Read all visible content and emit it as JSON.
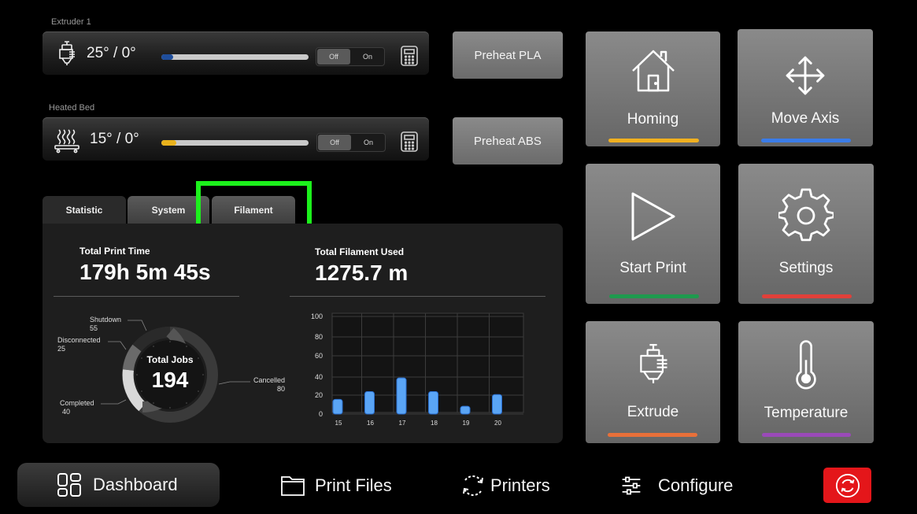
{
  "extruder": {
    "label": "Extruder 1",
    "temp": "25° / 0°",
    "progress": 0.08,
    "bar_color": "#1f4e9c",
    "toggle_off": "Off",
    "toggle_on": "On"
  },
  "bed": {
    "label": "Heated Bed",
    "temp": "15° / 0°",
    "progress": 0.1,
    "bar_color": "#e9b21c",
    "toggle_off": "Off",
    "toggle_on": "On"
  },
  "preheat": {
    "pla": "Preheat PLA",
    "abs": "Preheat ABS"
  },
  "tabs": {
    "statistic": "Statistic",
    "system": "System",
    "filament": "Filament"
  },
  "stats": {
    "print_time_label": "Total Print Time",
    "print_time_value": "179h 5m 45s",
    "filament_label": "Total Filament Used",
    "filament_value": "1275.7 m",
    "jobs_label": "Total Jobs",
    "jobs_value": "194",
    "donut": [
      {
        "name": "Shutdown",
        "value": "55"
      },
      {
        "name": "Disconnected",
        "value": "25"
      },
      {
        "name": "Cancelled",
        "value": "80"
      },
      {
        "name": "Completed",
        "value": "40"
      }
    ]
  },
  "chart_data": {
    "type": "bar",
    "categories": [
      "15",
      "16",
      "17",
      "18",
      "19",
      "20"
    ],
    "y_ticks": [
      "100",
      "80",
      "60",
      "40",
      "20",
      "0"
    ],
    "ylim": [
      0,
      100
    ],
    "series": [
      {
        "values": [
          15,
          23,
          37,
          23,
          8,
          20
        ],
        "color": "#5aa5f5"
      }
    ],
    "grid": true
  },
  "tiles": {
    "homing": {
      "label": "Homing",
      "accent": "#f0b020",
      "icon": "house-icon"
    },
    "move_axis": {
      "label": "Move Axis",
      "accent": "#3a7ce8",
      "icon": "move-arrows-icon"
    },
    "start_print": {
      "label": "Start Print",
      "accent": "#1f9a4e",
      "icon": "play-icon"
    },
    "settings": {
      "label": "Settings",
      "accent": "#e0403a",
      "icon": "gear-icon"
    },
    "extrude": {
      "label": "Extrude",
      "accent": "#e8703a",
      "icon": "extruder-icon"
    },
    "temperature": {
      "label": "Temperature",
      "accent": "#9a4ab8",
      "icon": "thermometer-icon"
    }
  },
  "nav": {
    "dashboard": "Dashboard",
    "print_files": "Print Files",
    "printers": "Printers",
    "configure": "Configure"
  }
}
